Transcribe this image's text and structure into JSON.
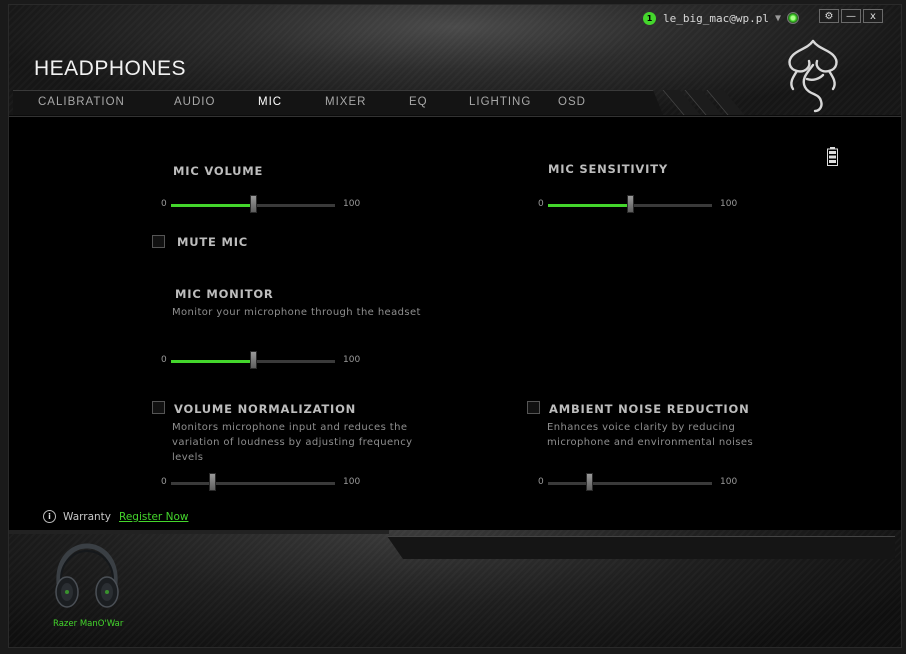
{
  "window": {
    "title": "HEADPHONES",
    "controls": [
      "⚙",
      "—",
      "x"
    ]
  },
  "user": {
    "badge": "1",
    "email": "le_big_mac@wp.pl",
    "caret": "▼"
  },
  "nav": {
    "tabs": [
      {
        "label": "CALIBRATION",
        "active": false
      },
      {
        "label": "AUDIO",
        "active": false
      },
      {
        "label": "MIC",
        "active": true
      },
      {
        "label": "MIXER",
        "active": false
      },
      {
        "label": "EQ",
        "active": false
      },
      {
        "label": "LIGHTING",
        "active": false
      },
      {
        "label": "OSD",
        "active": false
      }
    ]
  },
  "mic": {
    "volume": {
      "label": "MIC VOLUME",
      "min": "0",
      "max": "100",
      "value": 50
    },
    "sensitivity": {
      "label": "MIC SENSITIVITY",
      "min": "0",
      "max": "100",
      "value": 50
    },
    "mute": {
      "label": "MUTE MIC",
      "checked": false
    },
    "monitor": {
      "label": "MIC MONITOR",
      "description": "Monitor your microphone through the headset",
      "min": "0",
      "max": "100",
      "value": 50
    },
    "normalization": {
      "label": "VOLUME NORMALIZATION",
      "description": "Monitors microphone input and reduces the variation of loudness by adjusting frequency levels",
      "min": "0",
      "max": "100",
      "value": 25,
      "checked": false
    },
    "noise_reduction": {
      "label": "AMBIENT NOISE REDUCTION",
      "description": "Enhances voice clarity by reducing microphone and environmental noises",
      "min": "0",
      "max": "100",
      "value": 25,
      "checked": false
    }
  },
  "warranty": {
    "label": "Warranty",
    "link": "Register Now"
  },
  "device": {
    "name": "Razer ManO'War"
  },
  "colors": {
    "accent": "#44d62c",
    "background": "#000000",
    "text": "#bdbdbd"
  },
  "icons": {
    "settings": "gear-icon",
    "minimize": "minimize-icon",
    "close": "close-icon",
    "battery": "battery-icon",
    "info": "info-icon",
    "logo": "razer-logo-icon"
  }
}
